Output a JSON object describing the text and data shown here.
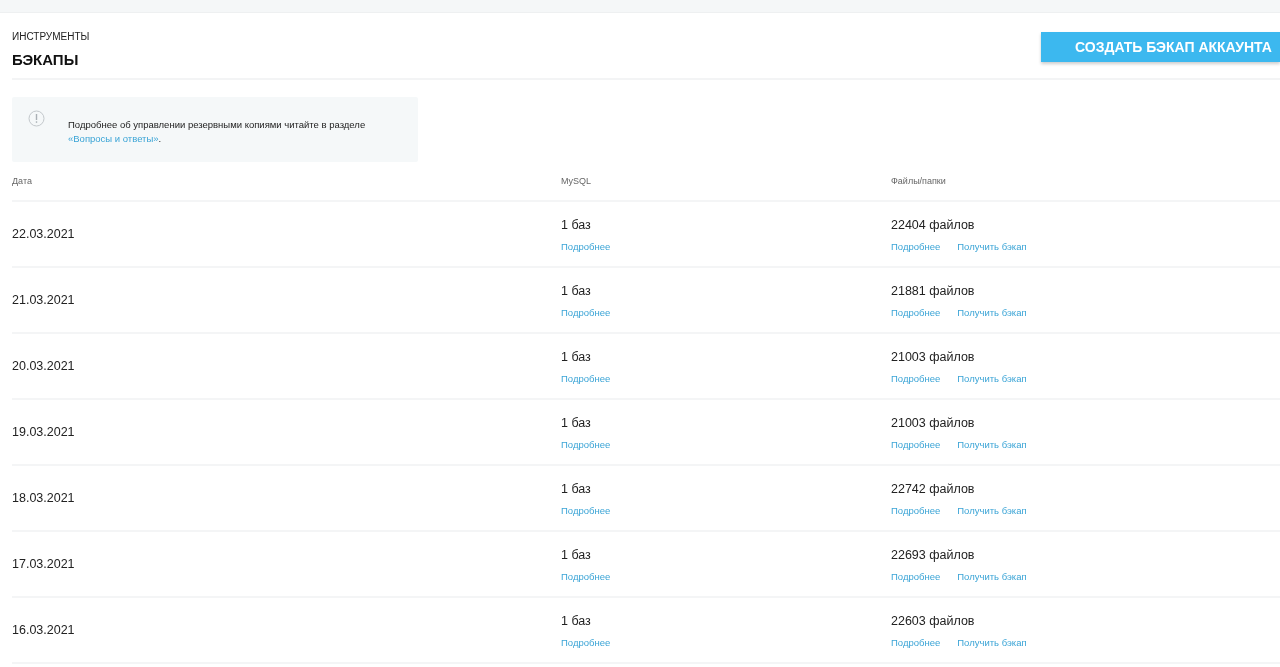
{
  "header": {
    "section": "ИНСТРУМЕНТЫ",
    "title": "БЭКАПЫ",
    "create_button": "СОЗДАТЬ БЭКАП АККАУНТА"
  },
  "info": {
    "text": "Подробнее об управлении резервными копиями читайте в разделе",
    "link": "«Вопросы и ответы»",
    "after_link": "."
  },
  "table": {
    "columns": [
      "Дата",
      "MySQL",
      "Файлы/папки"
    ],
    "rows": [
      {
        "date": "22.03.2021",
        "mysql": "1 баз",
        "mysql_link": "Подробнее",
        "files": "22404 файлов",
        "files_link": "Подробнее",
        "backup_link": "Получить бэкап"
      },
      {
        "date": "21.03.2021",
        "mysql": "1 баз",
        "mysql_link": "Подробнее",
        "files": "21881 файлов",
        "files_link": "Подробнее",
        "backup_link": "Получить бэкап"
      },
      {
        "date": "20.03.2021",
        "mysql": "1 баз",
        "mysql_link": "Подробнее",
        "files": "21003 файлов",
        "files_link": "Подробнее",
        "backup_link": "Получить бэкап"
      },
      {
        "date": "19.03.2021",
        "mysql": "1 баз",
        "mysql_link": "Подробнее",
        "files": "21003 файлов",
        "files_link": "Подробнее",
        "backup_link": "Получить бэкап"
      },
      {
        "date": "18.03.2021",
        "mysql": "1 баз",
        "mysql_link": "Подробнее",
        "files": "22742 файлов",
        "files_link": "Подробнее",
        "backup_link": "Получить бэкап"
      },
      {
        "date": "17.03.2021",
        "mysql": "1 баз",
        "mysql_link": "Подробнее",
        "files": "22693 файлов",
        "files_link": "Подробнее",
        "backup_link": "Получить бэкап"
      },
      {
        "date": "16.03.2021",
        "mysql": "1 баз",
        "mysql_link": "Подробнее",
        "files": "22603 файлов",
        "files_link": "Подробнее",
        "backup_link": "Получить бэкап"
      }
    ]
  }
}
